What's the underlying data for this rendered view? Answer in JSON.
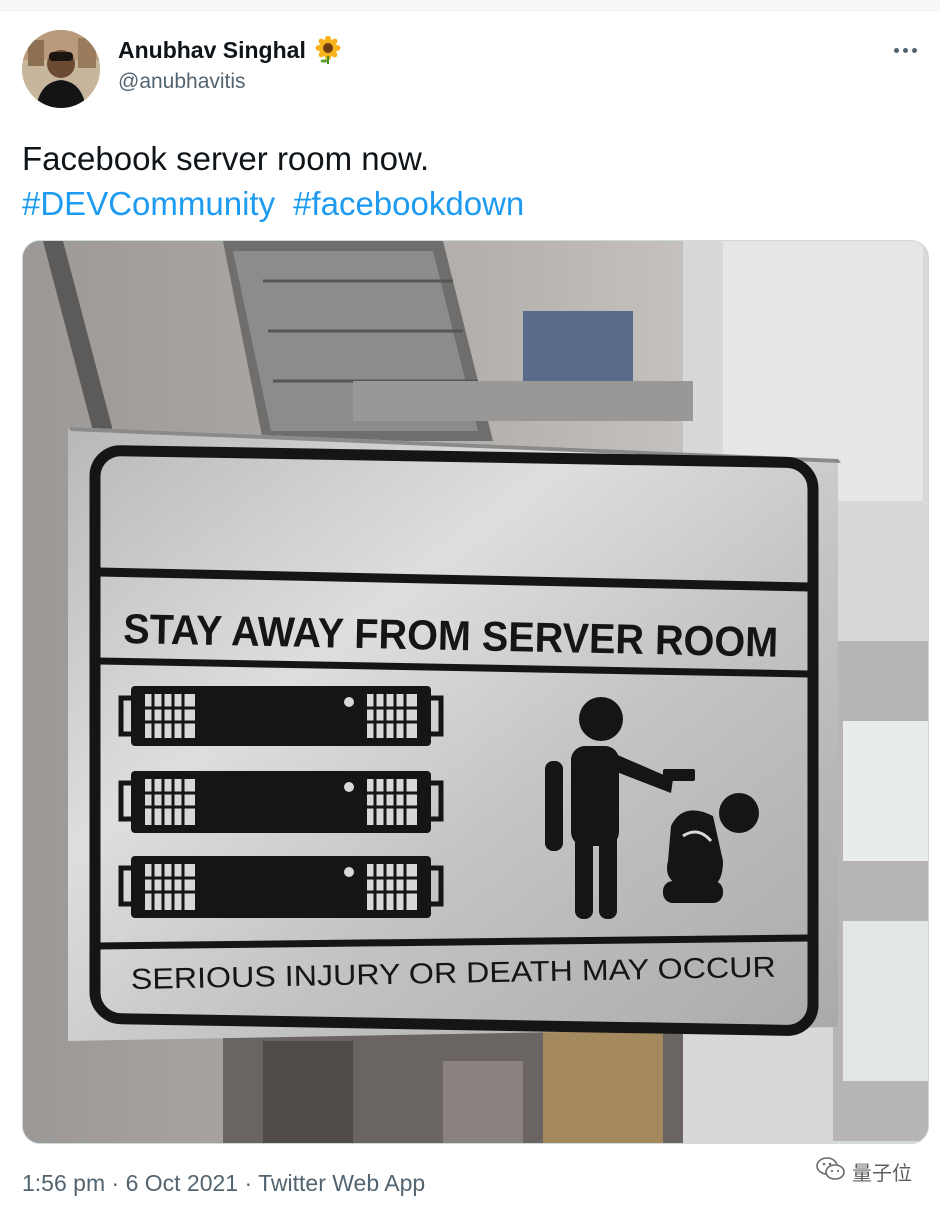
{
  "author": {
    "display_name": "Anubhav Singhal",
    "emoji": "sunflower-icon",
    "handle": "@anubhavitis"
  },
  "tweet": {
    "text": "Facebook server room now.",
    "hashtags": [
      "#DEVCommunity",
      "#facebookdown"
    ]
  },
  "media": {
    "sign_heading": "STAY AWAY FROM SERVER ROOM",
    "sign_footer": "SERIOUS INJURY OR DEATH MAY OCCUR"
  },
  "meta": {
    "time": "1:56 pm",
    "separator": "·",
    "date": "6 Oct 2021",
    "source": "Twitter Web App"
  },
  "watermark": {
    "text": "量子位",
    "icon": "wechat-icon"
  },
  "colors": {
    "accent": "#1d9bf0",
    "secondary_text": "#536471",
    "primary_text": "#0f1419"
  }
}
